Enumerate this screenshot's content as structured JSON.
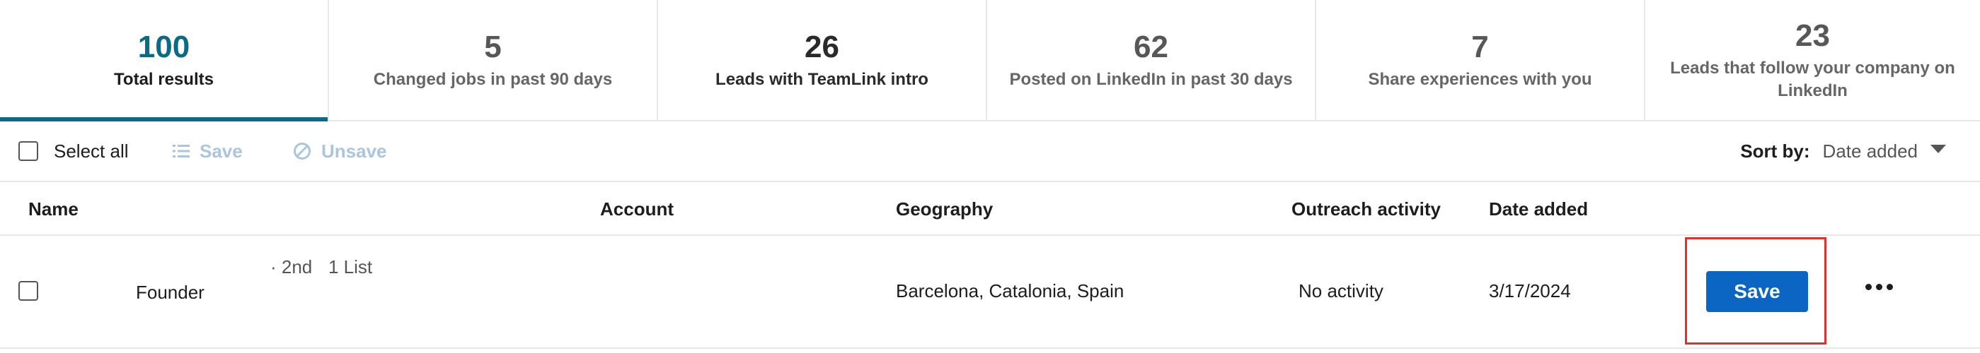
{
  "tabs": [
    {
      "count": "100",
      "label": "Total results"
    },
    {
      "count": "5",
      "label": "Changed jobs in past 90 days"
    },
    {
      "count": "26",
      "label": "Leads with TeamLink intro"
    },
    {
      "count": "62",
      "label": "Posted on LinkedIn in past 30 days"
    },
    {
      "count": "7",
      "label": "Share experiences with you"
    },
    {
      "count": "23",
      "label": "Leads that follow your company on LinkedIn"
    }
  ],
  "actionbar": {
    "select_all": "Select all",
    "save": "Save",
    "unsave": "Unsave",
    "sort_label": "Sort by:",
    "sort_value": "Date added"
  },
  "table": {
    "headers": {
      "name": "Name",
      "account": "Account",
      "geography": "Geography",
      "outreach": "Outreach activity",
      "date_added": "Date added"
    },
    "rows": [
      {
        "title": "Founder",
        "degree": "· 2nd",
        "lists": "1 List",
        "geography": "Barcelona, Catalonia, Spain",
        "outreach": "No activity",
        "date_added": "3/17/2024",
        "save_label": "Save"
      }
    ]
  },
  "colors": {
    "accent": "#0a6b86",
    "button_primary": "#0a66c2",
    "highlight": "#e0312a",
    "disabled_action": "#a9c6de"
  },
  "icons": {
    "save": "list-icon",
    "unsave": "cancel-circle-icon",
    "sort": "caret-down-icon",
    "more": "ellipsis-icon"
  }
}
